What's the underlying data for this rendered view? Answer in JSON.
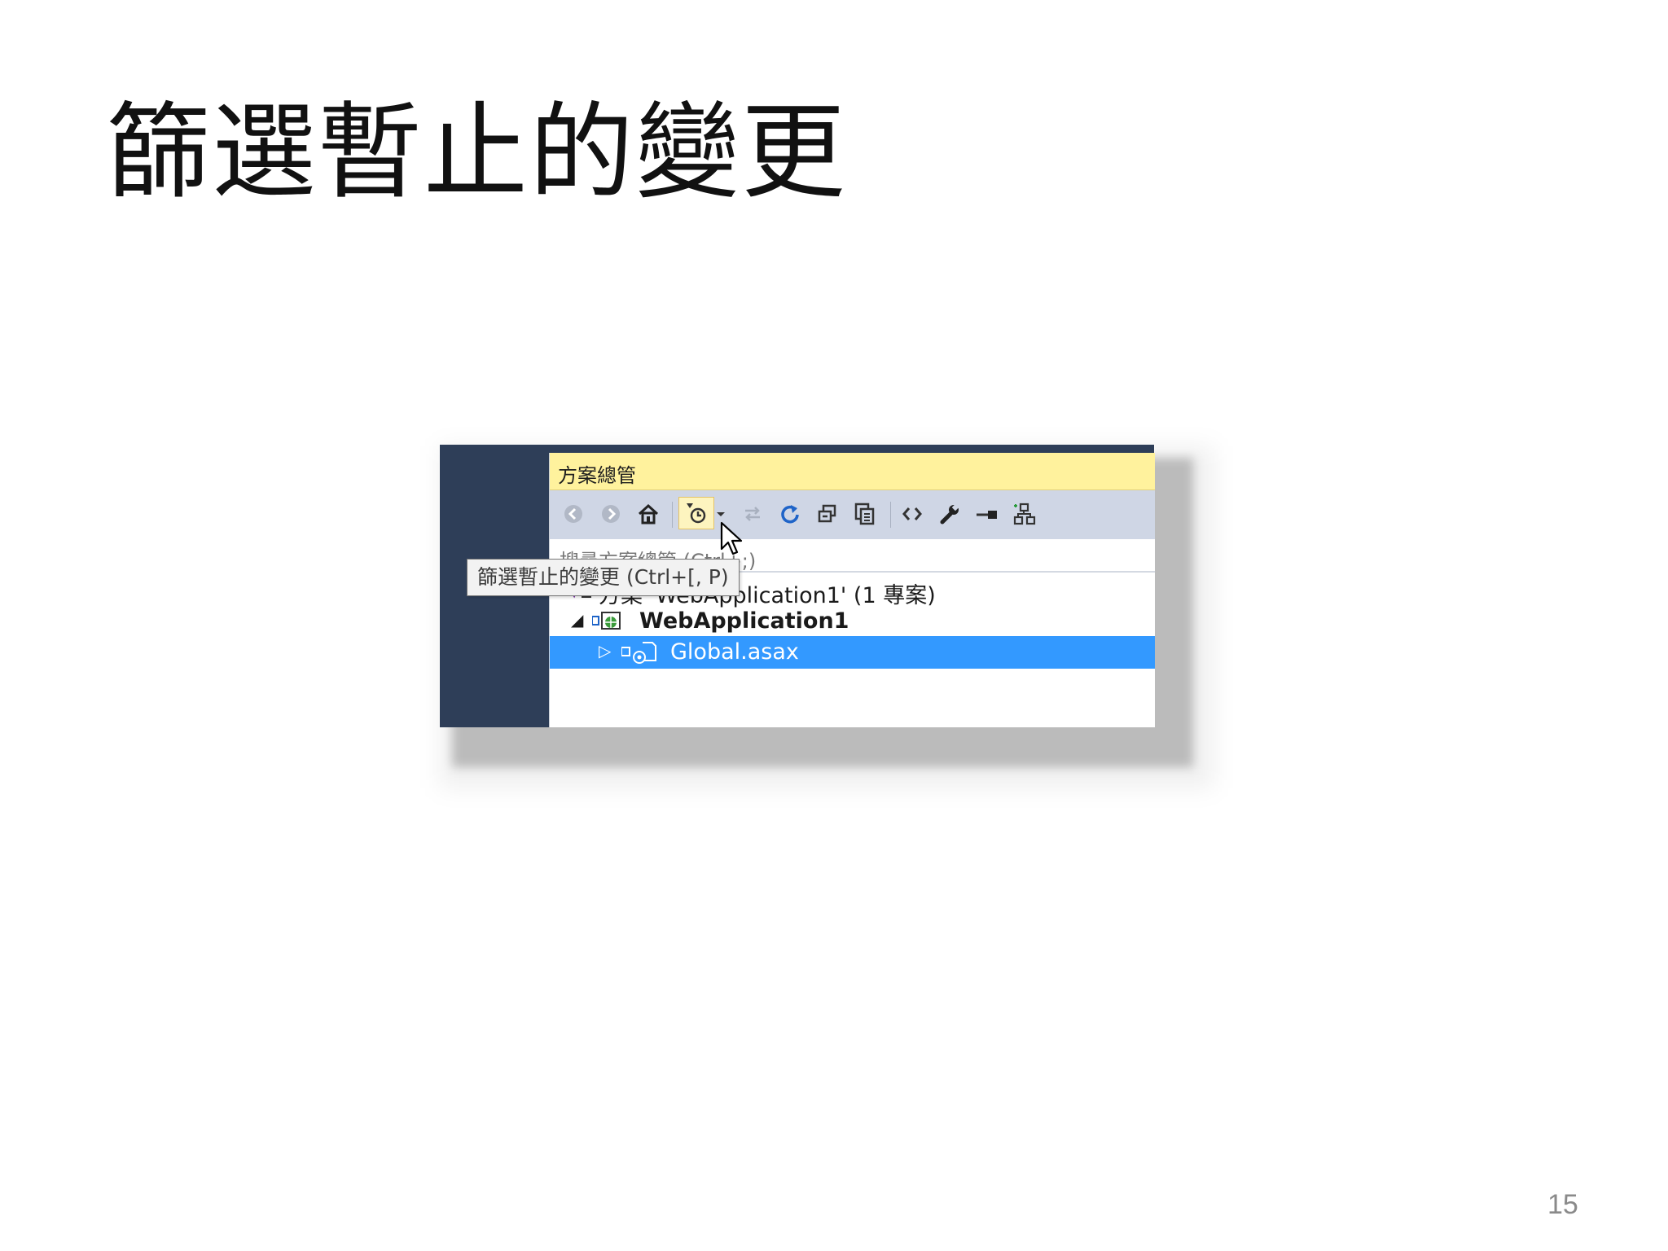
{
  "slide": {
    "title": "篩選暫止的變更",
    "page_number": "15"
  },
  "solution_explorer": {
    "title": "方案總管",
    "toolbar": {
      "icons": [
        "back-arrow-icon",
        "forward-arrow-icon",
        "home-icon",
        "pending-changes-filter-icon",
        "dropdown-arrow-icon",
        "sync-icon",
        "refresh-icon",
        "collapse-all-icon",
        "show-all-files-icon",
        "view-code-icon",
        "properties-wrench-icon",
        "preview-icon",
        "class-diagram-icon"
      ]
    },
    "search_placeholder": "搜尋方案總管 (Ctrl+;)",
    "tooltip": "篩選暫止的變更 (Ctrl+[, P)",
    "tree": {
      "solution": "方案 'WebApplication1' (1 專案)",
      "project": "WebApplication1",
      "file": "Global.asax"
    },
    "colors": {
      "title_bar": "#fff29d",
      "toolbar": "#cfd6e5",
      "selection": "#3399ff",
      "side_panel": "#2e3e58"
    }
  }
}
